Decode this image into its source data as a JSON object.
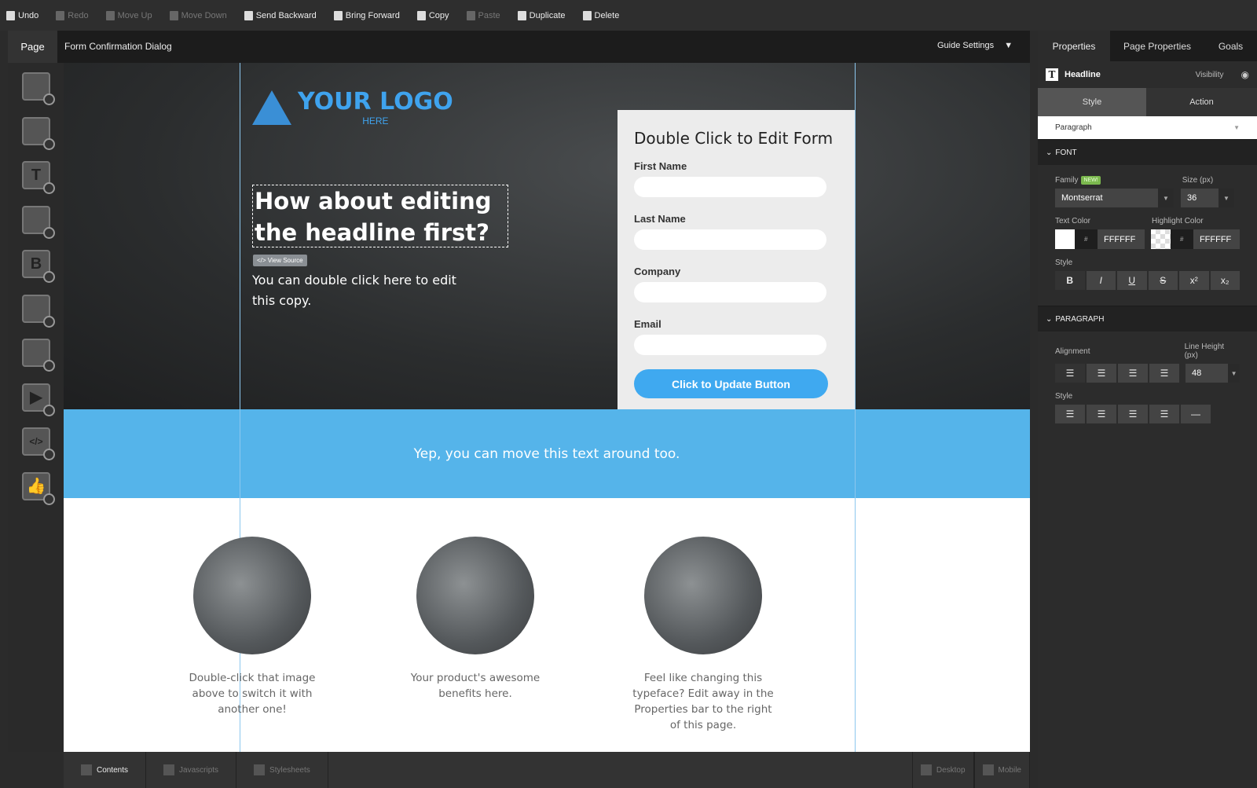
{
  "toolbar": {
    "items": [
      {
        "label": "Undo",
        "icon": "undo-icon",
        "enabled": true
      },
      {
        "label": "Redo",
        "icon": "redo-icon",
        "enabled": false
      },
      {
        "label": "Move Up",
        "icon": "move-up-icon",
        "enabled": false
      },
      {
        "label": "Move Down",
        "icon": "move-down-icon",
        "enabled": false
      },
      {
        "label": "Send Backward",
        "icon": "send-backward-icon",
        "enabled": true
      },
      {
        "label": "Bring Forward",
        "icon": "bring-forward-icon",
        "enabled": true
      },
      {
        "label": "Copy",
        "icon": "copy-icon",
        "enabled": true
      },
      {
        "label": "Paste",
        "icon": "paste-icon",
        "enabled": false
      },
      {
        "label": "Duplicate",
        "icon": "duplicate-icon",
        "enabled": true
      },
      {
        "label": "Delete",
        "icon": "trash-icon",
        "enabled": true
      }
    ]
  },
  "pagebar": {
    "tab": "Page",
    "name": "Form Confirmation Dialog",
    "guide": "Guide Settings"
  },
  "leftbar": {
    "tools": [
      "section-icon",
      "box-icon",
      "text-icon",
      "image-icon",
      "button-icon",
      "form-icon",
      "list-icon",
      "video-icon",
      "code-icon",
      "social-icon"
    ]
  },
  "canvas": {
    "logo": {
      "text": "YOUR LOGO",
      "sub": "HERE"
    },
    "headline": "How about editing the headline first?",
    "view_source": "</> View Source",
    "subcopy": "You can double click here to edit this copy.",
    "form": {
      "title": "Double Click to Edit Form",
      "fields": [
        "First Name",
        "Last Name",
        "Company",
        "Email"
      ],
      "button": "Click to Update Button"
    },
    "band_text": "Yep, you can move this text around too.",
    "features": [
      "Double-click that image above to switch it with another one!",
      "Your product's awesome benefits here.",
      "Feel like changing this typeface? Edit away in the Properties bar to the right of this page."
    ],
    "band_color": "#55b4ea"
  },
  "bottombar": {
    "left": [
      "Contents",
      "Javascripts",
      "Stylesheets"
    ],
    "right": [
      "Desktop",
      "Mobile"
    ]
  },
  "panel": {
    "tabs": [
      "Properties",
      "Page Properties",
      "Goals"
    ],
    "element": "Headline",
    "visibility": "Visibility",
    "subtabs": [
      "Style",
      "Action"
    ],
    "text_type": "Paragraph",
    "font": {
      "section": "FONT",
      "family_label": "Family",
      "new_badge": "NEW!",
      "family": "Montserrat",
      "size_label": "Size (px)",
      "size": "36",
      "text_color_label": "Text Color",
      "text_color": "FFFFFF",
      "highlight_label": "Highlight Color",
      "highlight_color": "FFFFFF",
      "hash": "#",
      "style_label": "Style",
      "styles": [
        "B",
        "I",
        "U",
        "S",
        "x²",
        "x₂"
      ]
    },
    "paragraph": {
      "section": "PARAGRAPH",
      "alignment_label": "Alignment",
      "line_height_label": "Line Height (px)",
      "line_height": "48",
      "style_label": "Style"
    }
  }
}
